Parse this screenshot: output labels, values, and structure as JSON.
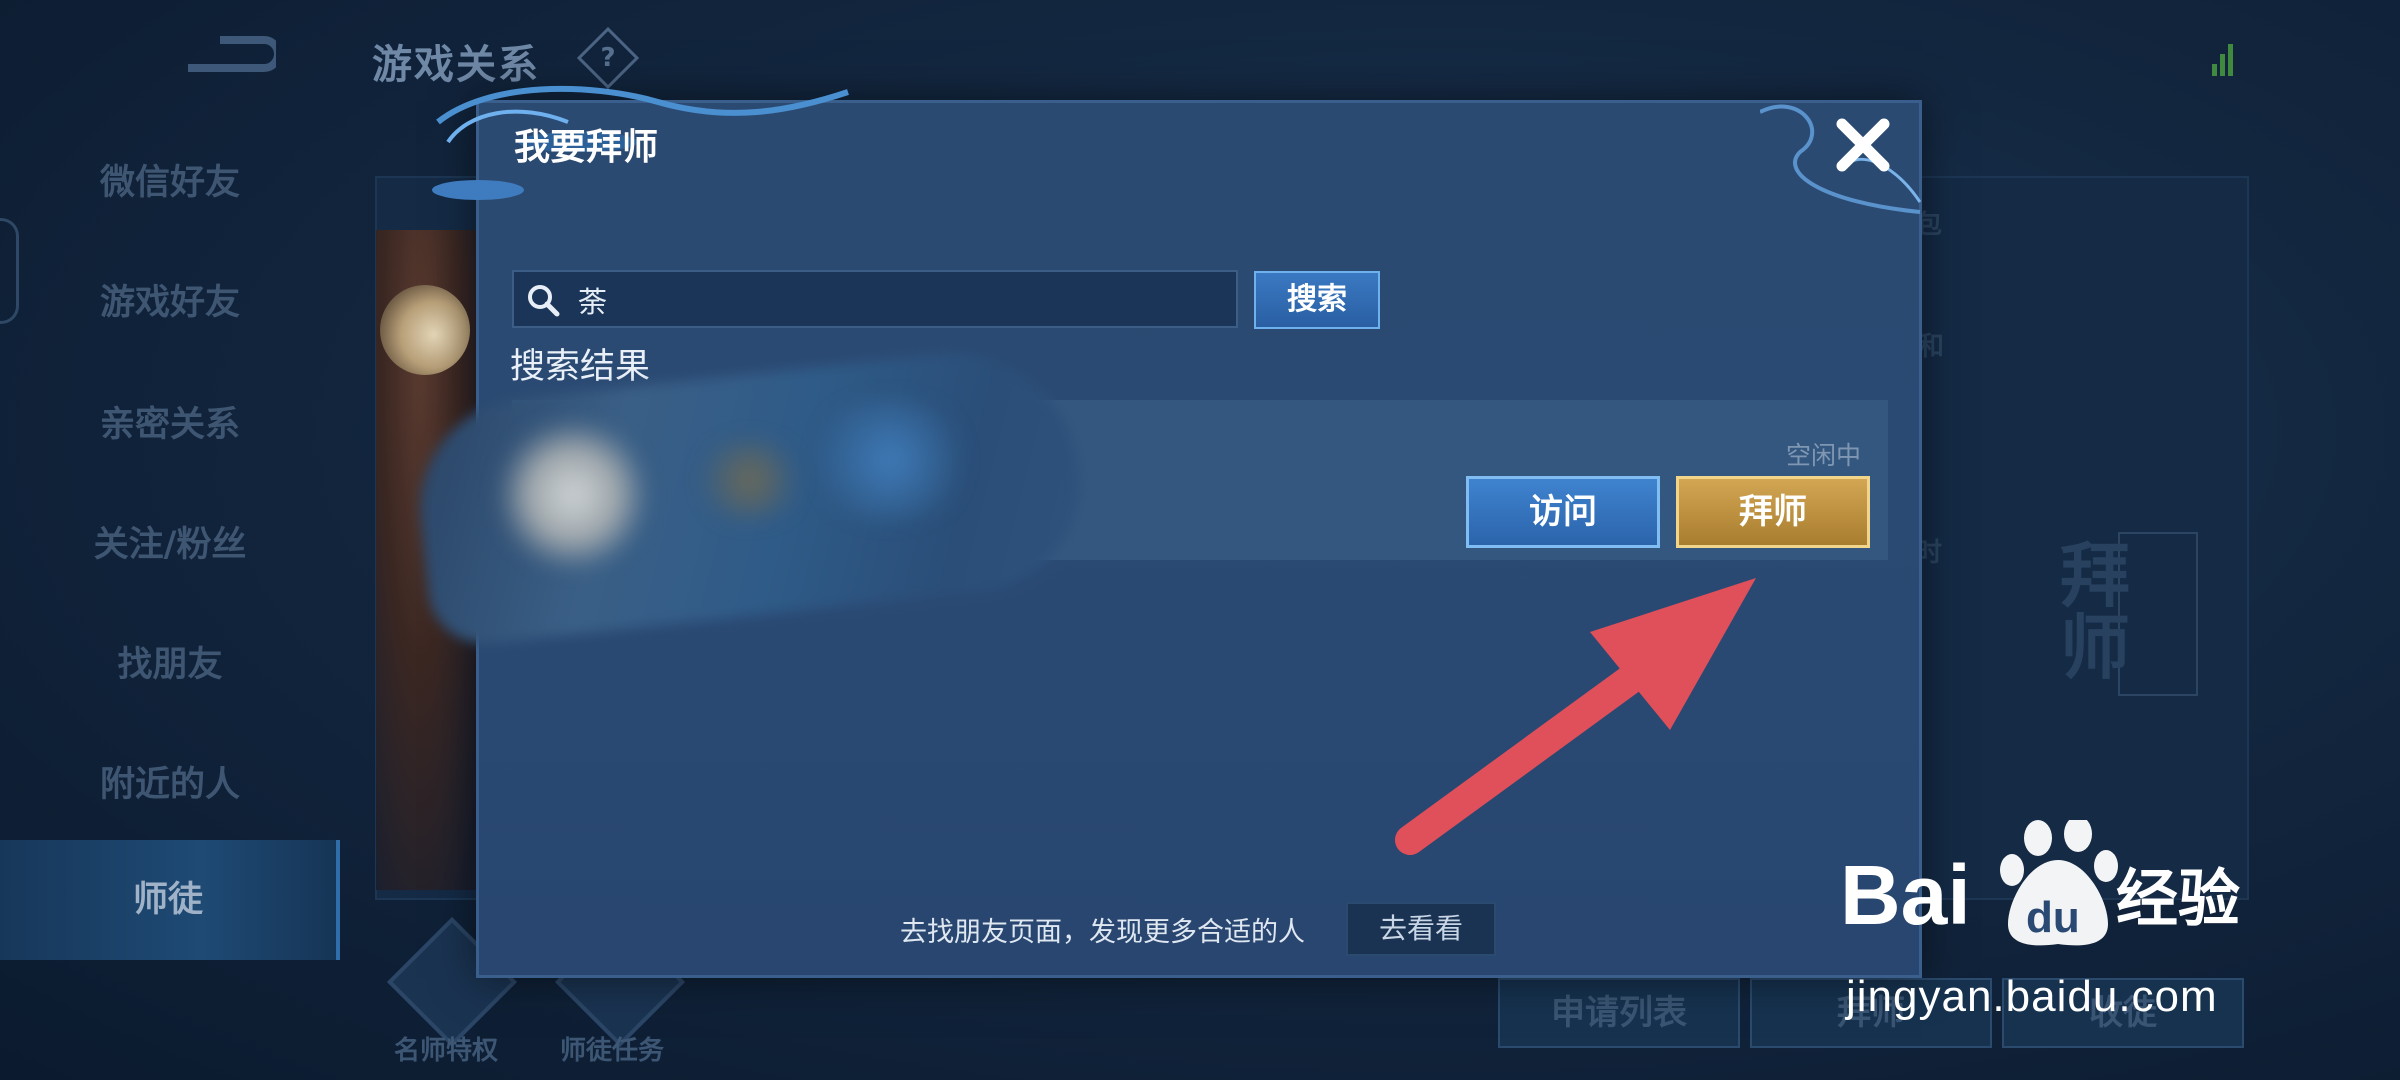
{
  "page": {
    "title": "游戏关系",
    "help_icon": "?"
  },
  "sidebar": {
    "items": [
      {
        "label": "微信好友"
      },
      {
        "label": "游戏好友"
      },
      {
        "label": "亲密关系"
      },
      {
        "label": "关注/粉丝"
      },
      {
        "label": "找朋友"
      },
      {
        "label": "附近的人"
      },
      {
        "label": "师徒"
      }
    ]
  },
  "background": {
    "right_texts": [
      "包",
      "和",
      "时"
    ],
    "deco_text": "拜师",
    "bottom_buttons": [
      "申请列表",
      "拜师",
      "收徒"
    ],
    "bottom_icons": [
      {
        "label": "名师特权",
        "icon": "crown-icon"
      },
      {
        "label": "师徒任务",
        "icon": "task-icon"
      }
    ]
  },
  "modal": {
    "title": "我要拜师",
    "close_icon": "close-icon",
    "search": {
      "value": "荼",
      "button_label": "搜索"
    },
    "results_label": "搜索结果",
    "result": {
      "status": "空闲中",
      "visit_label": "访问",
      "apprentice_label": "拜师"
    },
    "footer": {
      "text": "去找朋友页面，发现更多合适的人",
      "button_label": "去看看"
    }
  },
  "annotation": {
    "arrow_color": "#e0505a"
  },
  "watermark": {
    "brand": "Bai",
    "brand_du": "du",
    "product": "经验",
    "url": "jingyan.baidu.com"
  }
}
